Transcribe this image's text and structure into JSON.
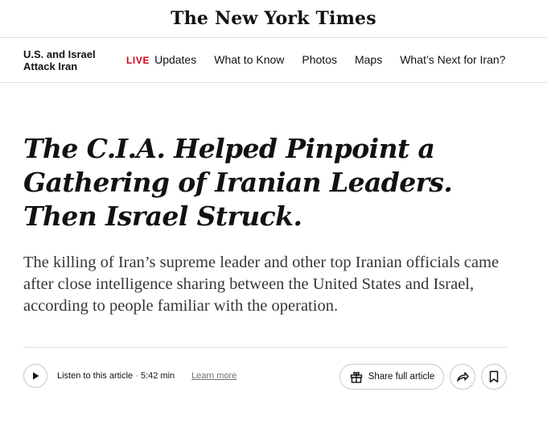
{
  "masthead": {
    "logo_text": "The New York Times"
  },
  "nav": {
    "section_title": "U.S. and Israel Attack Iran",
    "live_badge": "LIVE",
    "links": [
      "Updates",
      "What to Know",
      "Photos",
      "Maps",
      "What’s Next for Iran?"
    ]
  },
  "article": {
    "headline": "The C.I.A. Helped Pinpoint a Gathering of Iranian Leaders. Then Israel Struck.",
    "summary": "The killing of Iran’s supreme leader and other top Iranian officials came after close intelligence sharing between the United States and Israel, according to people familiar with the operation."
  },
  "audio": {
    "listen_label": "Listen to this article",
    "separator": "·",
    "duration": "5:42 min",
    "learn_more": "Learn more"
  },
  "actions": {
    "share_label": "Share full article",
    "icons": [
      "play-icon",
      "gift-icon",
      "share-arrow-icon",
      "bookmark-icon"
    ]
  }
}
